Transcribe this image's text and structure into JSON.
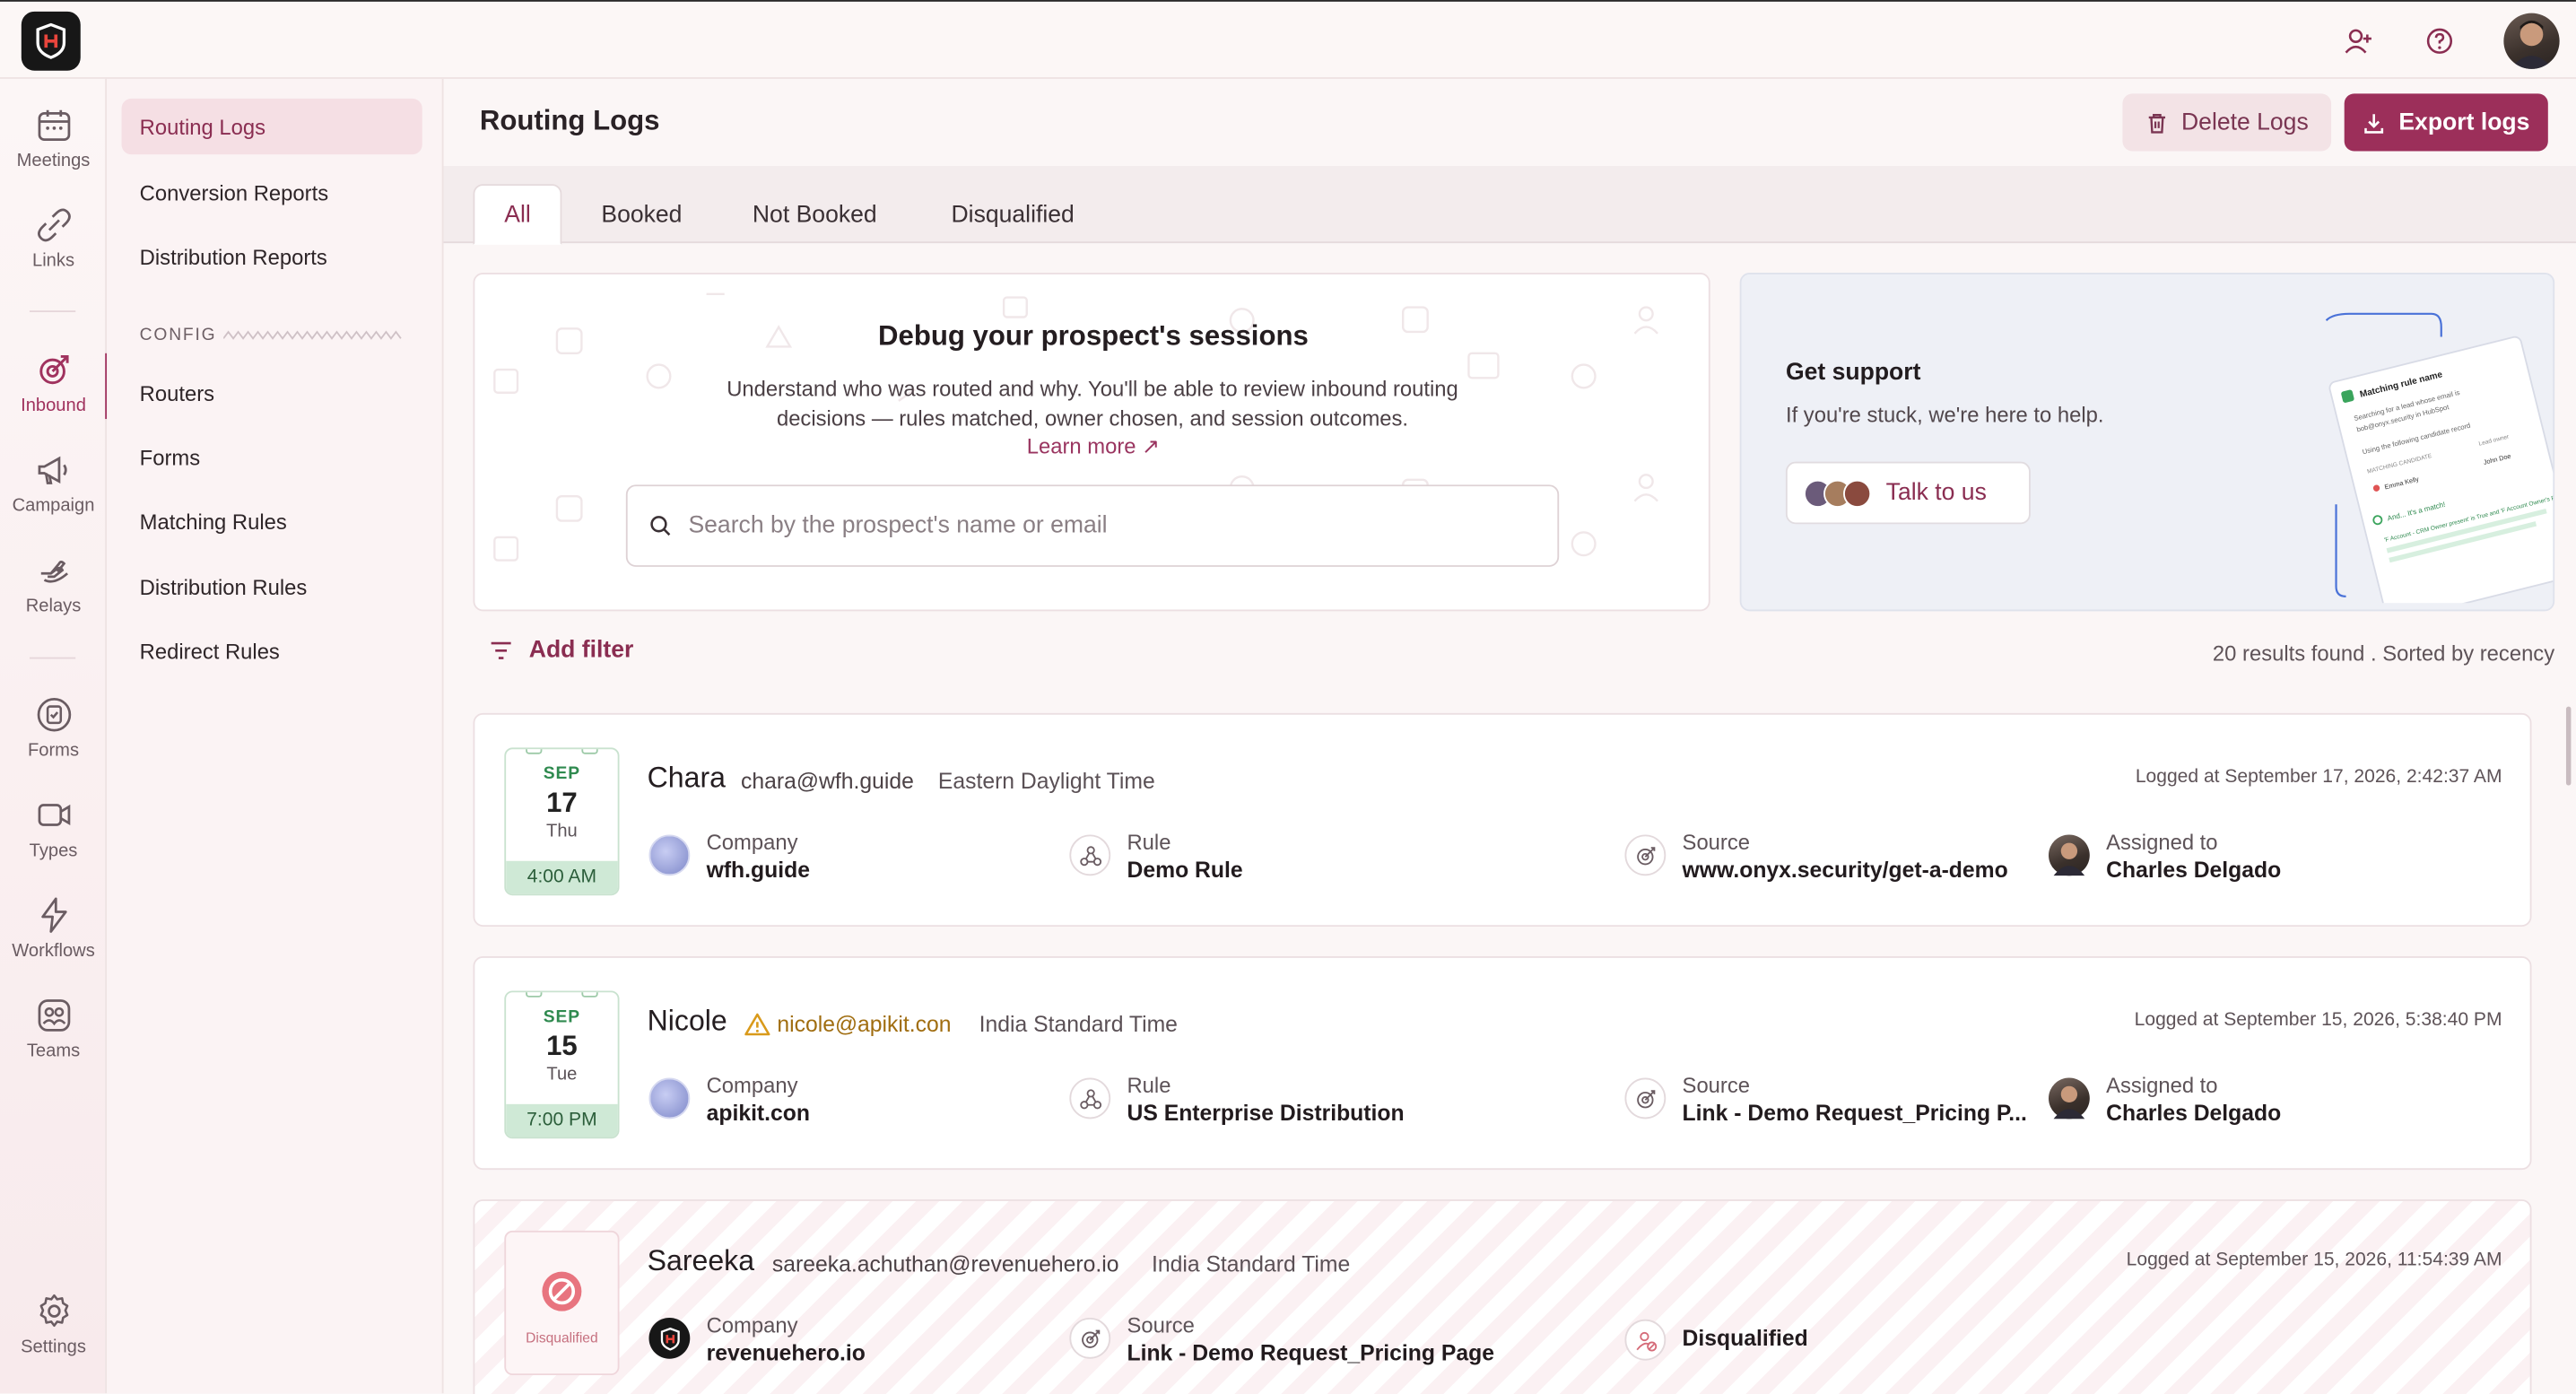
{
  "nav_rail": [
    {
      "label": "Meetings",
      "icon": "calendar-icon"
    },
    {
      "label": "Links",
      "icon": "link-icon"
    },
    {
      "label": "Inbound",
      "icon": "inbound-icon",
      "active": true
    },
    {
      "label": "Campaign",
      "icon": "megaphone-icon"
    },
    {
      "label": "Relays",
      "icon": "relay-hand-icon"
    },
    {
      "label": "Forms",
      "icon": "forms-icon"
    },
    {
      "label": "Types",
      "icon": "video-icon"
    },
    {
      "label": "Workflows",
      "icon": "lightning-icon"
    },
    {
      "label": "Teams",
      "icon": "teams-icon"
    },
    {
      "label": "Settings",
      "icon": "gear-icon"
    }
  ],
  "subnav": {
    "items_top": [
      "Routing Logs",
      "Conversion Reports",
      "Distribution Reports"
    ],
    "config_label": "CONFIG",
    "items_config": [
      "Routers",
      "Forms",
      "Matching Rules",
      "Distribution Rules",
      "Redirect Rules"
    ],
    "active": "Routing Logs"
  },
  "header": {
    "title": "Routing Logs",
    "delete_label": "Delete Logs",
    "export_label": "Export logs"
  },
  "tabs": [
    "All",
    "Booked",
    "Not Booked",
    "Disqualified"
  ],
  "debug": {
    "title": "Debug your prospect's sessions",
    "description": "Understand who was routed and why. You'll be able to review inbound routing decisions — rules matched, owner chosen, and session outcomes.",
    "learn_more": "Learn more ↗",
    "search_placeholder": "Search by the prospect's name or email"
  },
  "support": {
    "title": "Get support",
    "subtitle": "If you're stuck, we're here to help.",
    "button": "Talk to us",
    "illustration": {
      "card_title": "Matching rule name",
      "line1": "Searching for a lead whose email is",
      "line2": "bob@onyx.security in HubSpot",
      "line3": "Using the following candidate record",
      "col1": "MATCHING CANDIDATE",
      "col2": "Lead owner",
      "lead": "Emma Kelly",
      "owner": "John Doe",
      "match": "And... It's a match!",
      "footer": "'F Account - CRM Owner present' is True and 'F Account Owner's Roundrobin Team' is ..."
    }
  },
  "filter": {
    "add_filter": "Add filter",
    "results": "20 results found . Sorted by recency"
  },
  "logs": [
    {
      "month": "SEP",
      "day": "17",
      "weekday": "Thu",
      "time": "4:00 AM",
      "name": "Chara",
      "email": "chara@wfh.guide",
      "timezone": "Eastern Daylight Time",
      "logged": "Logged at September 17, 2026, 2:42:37 AM",
      "company_label": "Company",
      "company": "wfh.guide",
      "rule_label": "Rule",
      "rule": "Demo Rule",
      "source_label": "Source",
      "source": "www.onyx.security/get-a-demo",
      "assigned_label": "Assigned to",
      "assigned": "Charles Delgado"
    },
    {
      "month": "SEP",
      "day": "15",
      "weekday": "Tue",
      "time": "7:00 PM",
      "name": "Nicole",
      "email": "nicole@apikit.con",
      "timezone": "India Standard Time",
      "logged": "Logged at September 15, 2026, 5:38:40 PM",
      "company_label": "Company",
      "company": "apikit.con",
      "rule_label": "Rule",
      "rule": "US Enterprise Distribution",
      "source_label": "Source",
      "source": "Link - Demo Request_Pricing P...",
      "assigned_label": "Assigned to",
      "assigned": "Charles Delgado"
    },
    {
      "status": "Disqualified",
      "name": "Sareeka",
      "email": "sareeka.achuthan@revenuehero.io",
      "timezone": "India Standard Time",
      "logged": "Logged at September 15, 2026, 11:54:39 AM",
      "company_label": "Company",
      "company": "revenuehero.io",
      "source_label": "Source",
      "source": "Link - Demo Request_Pricing Page",
      "outcome": "Disqualified"
    }
  ],
  "colors": {
    "brand": "#9c2f5a",
    "date_green": "#cfe9d6",
    "warning": "#d99a1b"
  }
}
